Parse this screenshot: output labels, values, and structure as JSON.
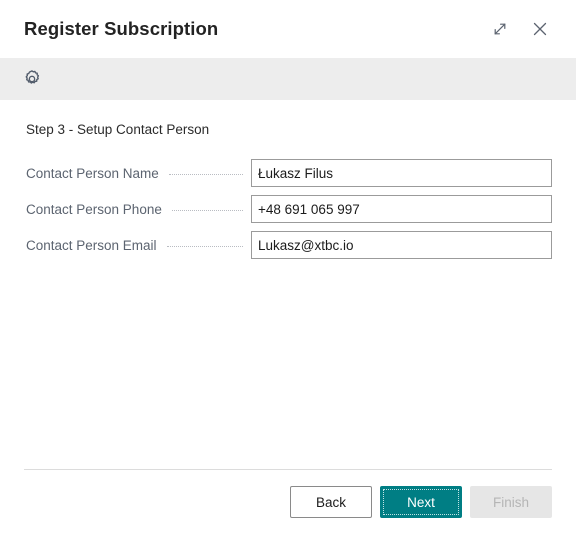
{
  "window": {
    "title": "Register Subscription",
    "expand_icon": "expand-diagonal-icon",
    "close_icon": "close-icon"
  },
  "toolbar": {
    "settings_icon": "gear-icon"
  },
  "content": {
    "step_heading": "Step 3 - Setup Contact Person",
    "fields": [
      {
        "label": "Contact Person Name",
        "value": "Łukasz Filus",
        "placeholder": ""
      },
      {
        "label": "Contact Person Phone",
        "value": "+48 691 065 997",
        "placeholder": ""
      },
      {
        "label": "Contact Person Email",
        "value": "Lukasz@xtbc.io",
        "placeholder": ""
      }
    ]
  },
  "footer": {
    "back_label": "Back",
    "next_label": "Next",
    "finish_label": "Finish"
  },
  "colors": {
    "accent_teal": "#007E84",
    "toolbar_gray": "#EDEDED",
    "label_gray": "#5C6470",
    "disabled_bg": "#E6E6E6",
    "disabled_text": "#B5B5B5",
    "border_gray": "#9B9B9B"
  }
}
